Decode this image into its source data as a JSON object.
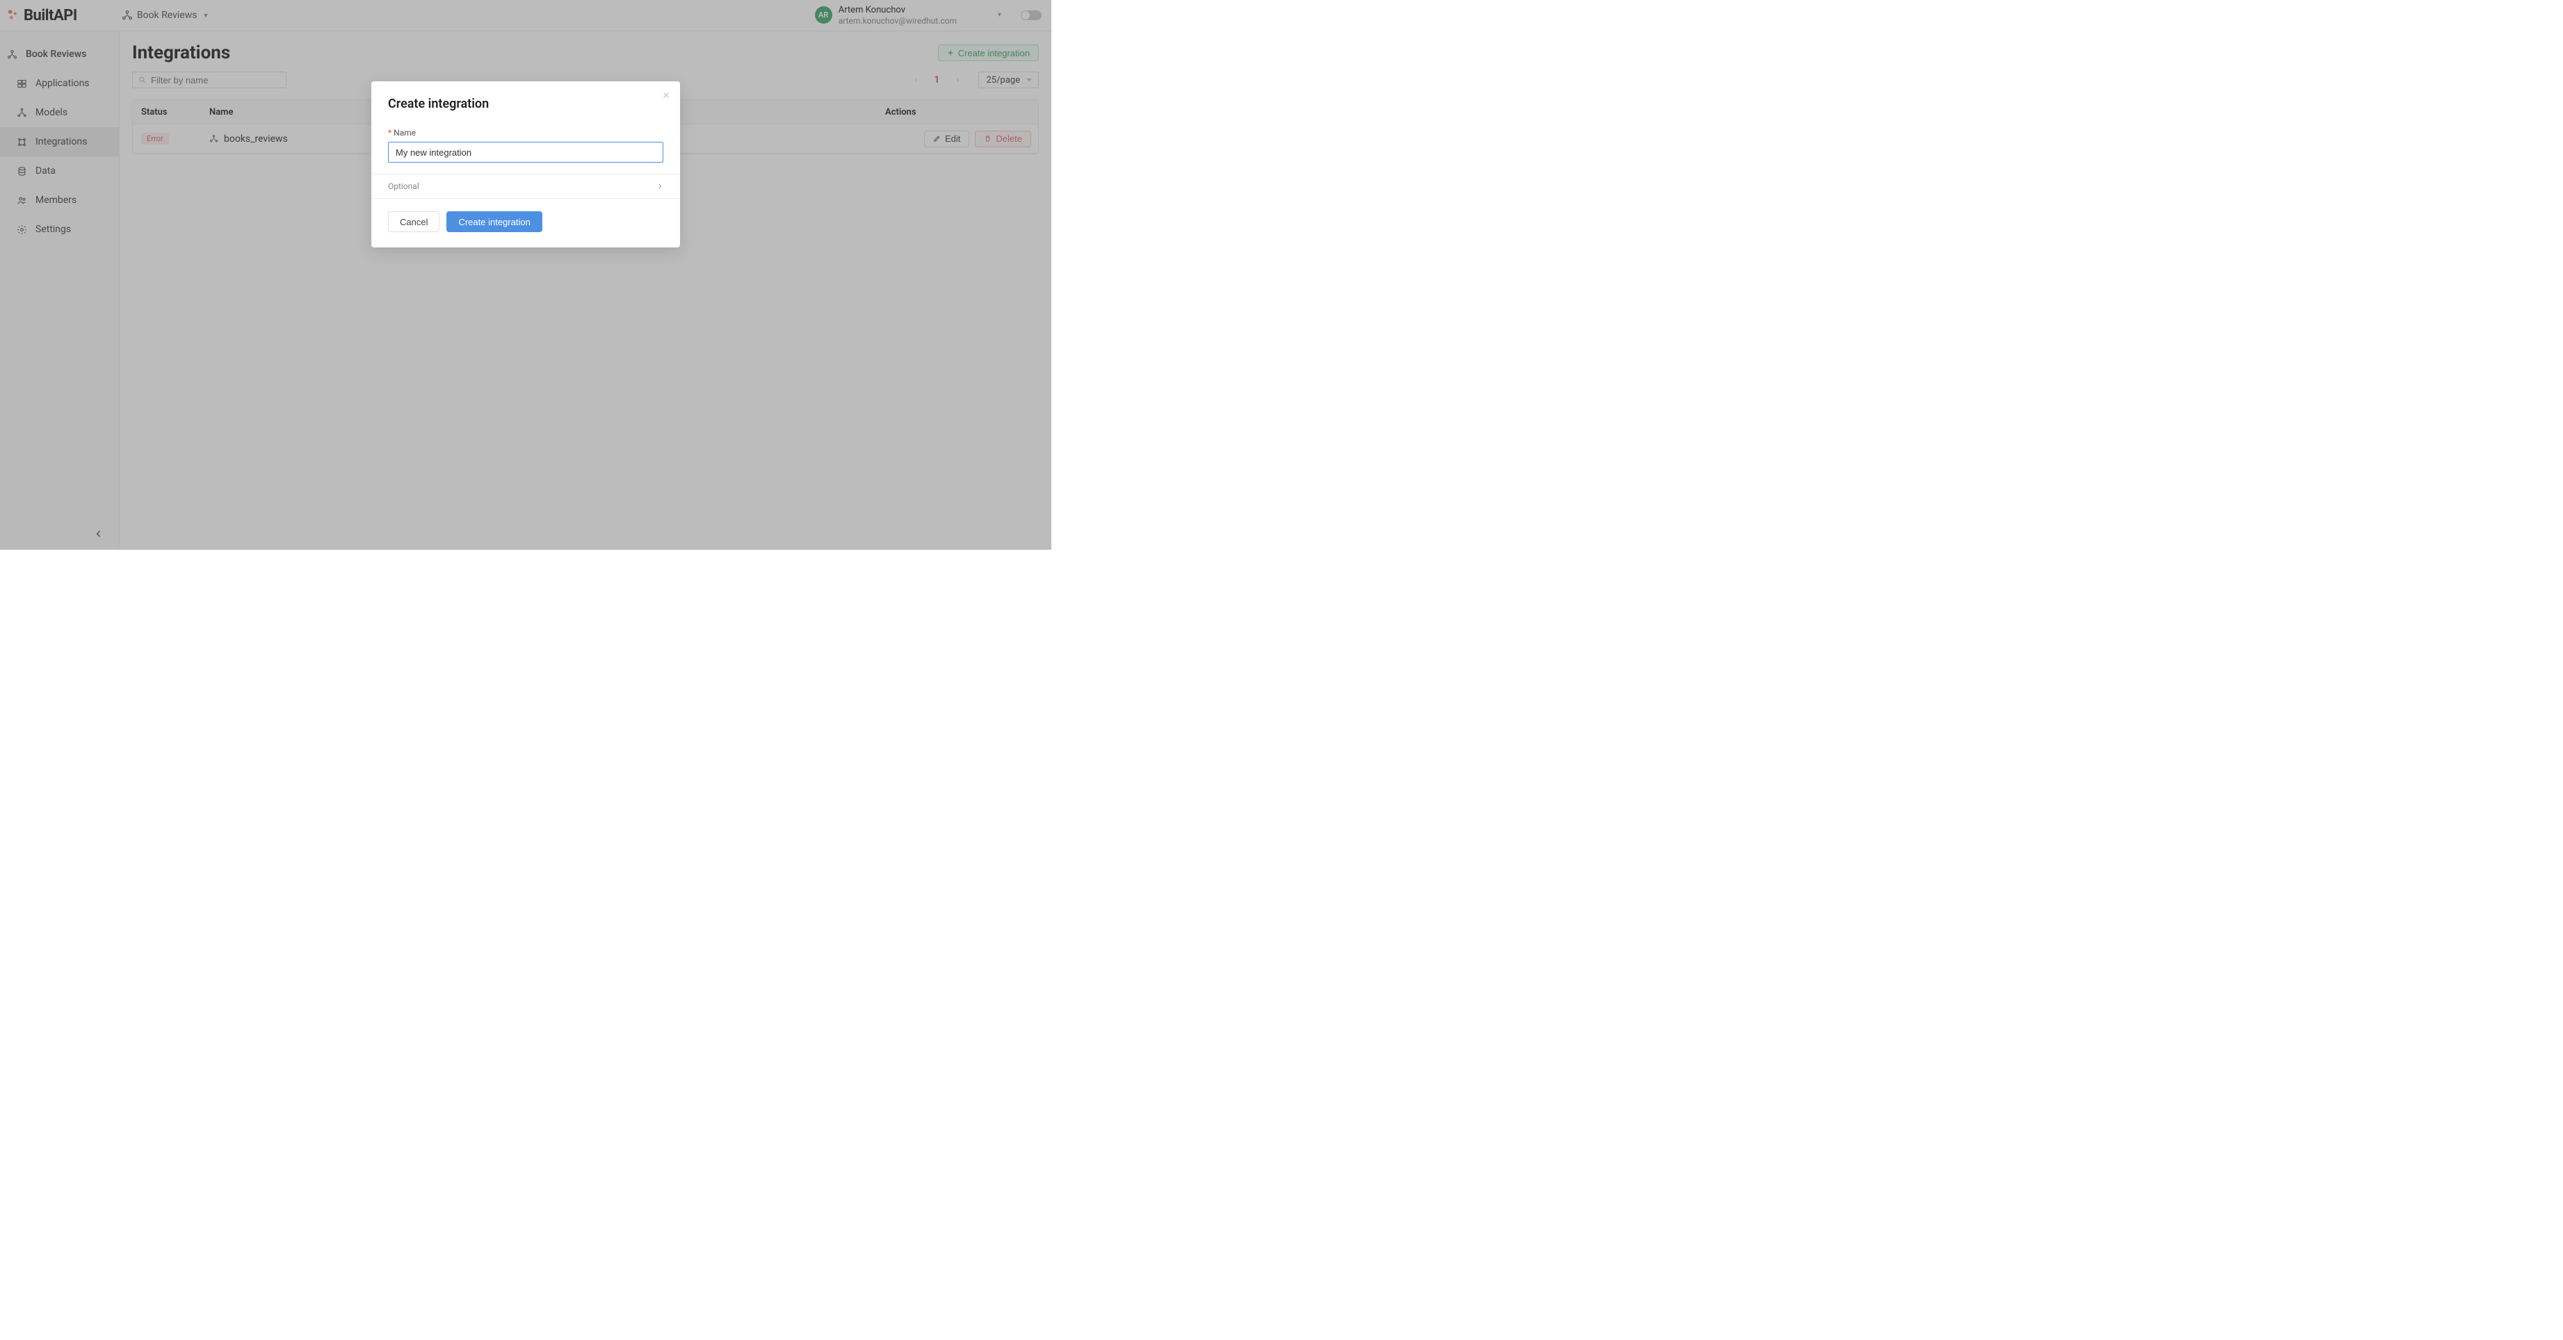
{
  "brand": {
    "name": "BuiltAPI"
  },
  "breadcrumb": {
    "project": "Book Reviews"
  },
  "user": {
    "initials": "AR",
    "name": "Artem Konuchov",
    "email": "artem.konuchov@wiredhut.com"
  },
  "sidebar": {
    "project": "Book Reviews",
    "items": [
      {
        "label": "Applications"
      },
      {
        "label": "Models"
      },
      {
        "label": "Integrations",
        "active": true
      },
      {
        "label": "Data"
      },
      {
        "label": "Members"
      },
      {
        "label": "Settings"
      }
    ]
  },
  "page": {
    "title": "Integrations",
    "create_button": "Create integration",
    "filter_placeholder": "Filter by name"
  },
  "pagination": {
    "current": "1",
    "page_size": "25/page"
  },
  "table": {
    "headers": {
      "status": "Status",
      "name": "Name",
      "actions": "Actions"
    },
    "rows": [
      {
        "status": "Error",
        "name": "books_reviews"
      }
    ],
    "actions": {
      "edit": "Edit",
      "delete": "Delete"
    }
  },
  "modal": {
    "title": "Create integration",
    "name_label": "Name",
    "name_value": "My new integration",
    "optional_label": "Optional",
    "cancel": "Cancel",
    "submit": "Create integration"
  }
}
